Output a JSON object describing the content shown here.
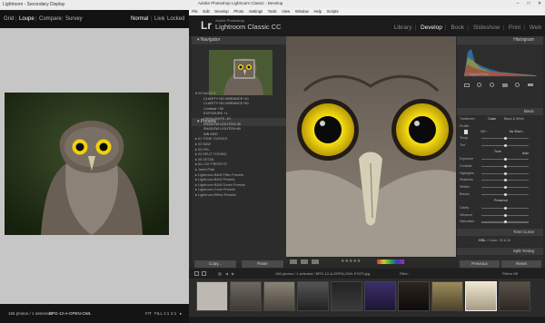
{
  "secondary": {
    "window_title": "Lightroom - Secondary Display",
    "tabs": [
      "Grid",
      "Loupe",
      "Compare",
      "Survey"
    ],
    "active_tab": "Loupe",
    "modes": [
      "Normal",
      "Live",
      "Locked"
    ],
    "active_mode": "Normal",
    "status_count": "166 photos / 1 selected /",
    "status_file": "BPG-12-A-OPEN-OWL",
    "status_right": [
      "FIT",
      "FILL",
      "1:1",
      "2:1",
      "▸"
    ]
  },
  "main": {
    "window_title": "Adobe Photoshop Lightroom Classic - Develop",
    "menu": [
      "File",
      "Edit",
      "Develop",
      "Photo",
      "Settings",
      "Tools",
      "View",
      "Window",
      "Help",
      "Scripts"
    ],
    "logo": "Lr",
    "brand_small": "Adobe Photoshop",
    "brand": "Lightroom Classic CC",
    "modules": [
      "Library",
      "Develop",
      "Book",
      "Slideshow",
      "Print",
      "Web"
    ],
    "active_module": "Develop",
    "navigator_label": "Navigator",
    "presets_label": "Presets",
    "presets": [
      {
        "label": "▾ 00 BASICS",
        "sub": false
      },
      {
        "label": "CLARITY+30-VIBRANCE+10",
        "sub": true
      },
      {
        "label": "CLARITY+30-VIBRANCE+30",
        "sub": true
      },
      {
        "label": "Contrast +30",
        "sub": true
      },
      {
        "label": "EXPOSURE +1",
        "sub": true
      },
      {
        "label": "HIGHLIGHTS -40",
        "sub": true
      },
      {
        "label": "SHADOW LIGHTEN+30",
        "sub": true
      },
      {
        "label": "SHADOW LIGHTEN+60",
        "sub": true
      },
      {
        "label": "WB 4300",
        "sub": true
      },
      {
        "label": "▸ 01 TONE CURVES",
        "sub": false
      },
      {
        "label": "▸ 02 B&W",
        "sub": false
      },
      {
        "label": "▸ 03 HSL",
        "sub": false
      },
      {
        "label": "▸ 04 SPLIT TONING",
        "sub": false
      },
      {
        "label": "▸ 05 DETAIL",
        "sub": false
      },
      {
        "label": "▸ ALL MY PRESETS",
        "sub": false
      },
      {
        "label": "▸ Jared Platt",
        "sub": false
      },
      {
        "label": "▸ Lightroom B&W Filter Presets",
        "sub": false
      },
      {
        "label": "▸ Lightroom B&W Presets",
        "sub": false
      },
      {
        "label": "▸ Lightroom B&W Toned Presets",
        "sub": false
      },
      {
        "label": "▸ Lightroom Color Presets",
        "sub": false
      },
      {
        "label": "▸ Lightroom Effect Presets",
        "sub": false
      }
    ],
    "copy_label": "Copy...",
    "paste_label": "Paste",
    "histogram_label": "Histogram",
    "original_photo_label": "Original Photo",
    "basic_label": "Basic",
    "treatment": [
      "Treatment :",
      "Color",
      "Black & White"
    ],
    "profile_label": "Profile :",
    "wb_label": "WB :",
    "wb_value": "As Shot ↕",
    "basic_rows": [
      "Temp",
      "Tint",
      "Tone",
      "Exposure",
      "Contrast",
      "Highlights",
      "Shadows",
      "Whites",
      "Blacks",
      "Presence",
      "Clarity",
      "Vibrance",
      "Saturation"
    ],
    "auto_label": "Auto",
    "tone_curve_label": "Tone Curve",
    "hsl_tabs": [
      "HSL",
      "/",
      "Color",
      "/",
      "B & W"
    ],
    "split_toning_label": "Split Toning",
    "previous_label": "Previous",
    "reset_label": "Reset",
    "filmstrip_info": "166 photos / 1 selected / BPG-12-A-OPEN-OWL EYES.jpg",
    "filter_label": "Filter :",
    "filter_value": "Filters Off"
  },
  "colors": {
    "lr_dark": "#282828",
    "panel": "#2c2c2c",
    "panel_header": "#3a3a3a",
    "active_module": "#f2f2f2",
    "owl_eye": "#f0d20a"
  }
}
